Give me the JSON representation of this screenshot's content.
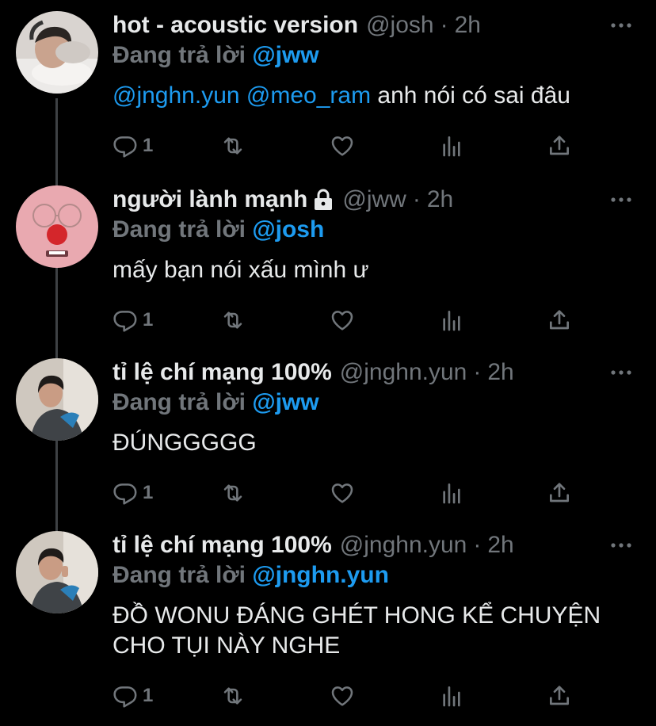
{
  "thread": {
    "tweets": [
      {
        "name": "hot - acoustic version",
        "handle": "@josh",
        "dot": "·",
        "time": "2h",
        "locked": false,
        "replying_prefix": "Đang trả lời",
        "replying_to": "@jww",
        "mentions": [
          "@jnghn.yun",
          "@meo_ram"
        ],
        "text": "anh nói có sai đâu",
        "text_line2": "",
        "reply_count": "1",
        "avatar": "avatar-person-pillow"
      },
      {
        "name": "người lành mạnh",
        "handle": "@jww",
        "dot": "·",
        "time": "2h",
        "locked": true,
        "replying_prefix": "Đang trả lời",
        "replying_to": "@josh",
        "mentions": [],
        "text": "mấy bạn nói xấu mình ư",
        "text_line2": "",
        "reply_count": "1",
        "avatar": "avatar-pink-character"
      },
      {
        "name": "tỉ lệ chí mạng 100%",
        "handle": "@jnghn.yun",
        "dot": "·",
        "time": "2h",
        "locked": false,
        "replying_prefix": "Đang trả lời",
        "replying_to": "@jww",
        "mentions": [],
        "text": "ĐÚNGGGGG",
        "text_line2": "",
        "reply_count": "1",
        "avatar": "avatar-person-blue"
      },
      {
        "name": "tỉ lệ chí mạng 100%",
        "handle": "@jnghn.yun",
        "dot": "·",
        "time": "2h",
        "locked": false,
        "replying_prefix": "Đang trả lời",
        "replying_to": "@jnghn.yun",
        "mentions": [],
        "text": "ĐỒ WONU ĐÁNG GHÉT HONG KỂ CHUYỆN",
        "text_line2": "CHO TỤI NÀY NGHE",
        "reply_count": "1",
        "avatar": "avatar-person-blue"
      }
    ]
  },
  "icons": {
    "reply": "reply-icon",
    "retweet": "retweet-icon",
    "like": "heart-icon",
    "views": "views-icon",
    "share": "share-icon",
    "more": "more-icon",
    "lock": "lock-icon"
  },
  "colors": {
    "background": "#000000",
    "text": "#e7e9ea",
    "muted": "#71767b",
    "link": "#1d9bf0",
    "thread_line": "#3e4144"
  }
}
